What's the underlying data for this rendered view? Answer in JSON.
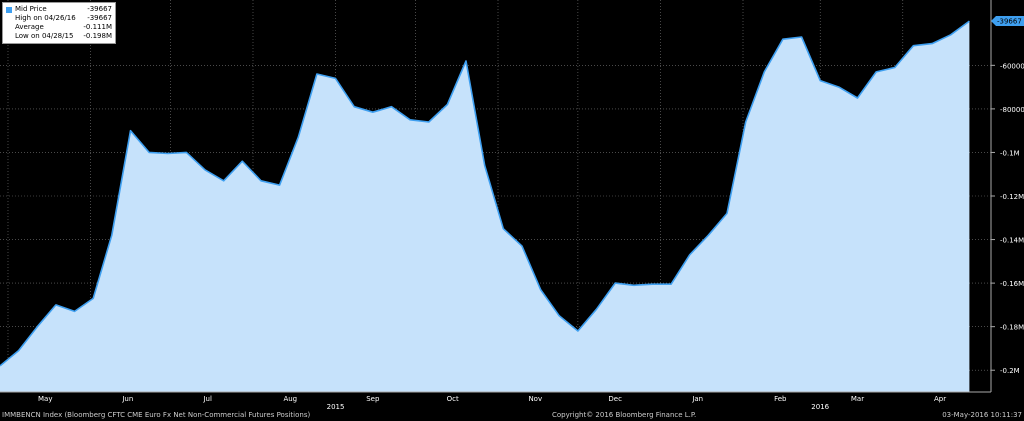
{
  "legend": {
    "series_label": "Mid Price",
    "series_value": "-39667",
    "high_label": "High on 04/26/16",
    "high_value": "-39667",
    "avg_label": "Average",
    "avg_value": "-0.111M",
    "low_label": "Low on 04/28/15",
    "low_value": "-0.198M"
  },
  "footer": {
    "left": "IMMBENCN Index (Bloomberg CFTC CME Euro Fx Net Non-Commercial Futures Positions)",
    "center": "Copyright© 2016 Bloomberg Finance L.P.",
    "right": "03-May-2016 10:11:37"
  },
  "colors": {
    "line": "#3e9ff0",
    "fill": "#c6e2fb",
    "background": "#000000",
    "grid": "#888888"
  },
  "chart_data": {
    "type": "area",
    "ylim": [
      -210000,
      -30000
    ],
    "y_ticks": [
      {
        "v": -60000,
        "label": "-60000"
      },
      {
        "v": -80000,
        "label": "-80000"
      },
      {
        "v": -100000,
        "label": "-0.1M"
      },
      {
        "v": -120000,
        "label": "-0.12M"
      },
      {
        "v": -140000,
        "label": "-0.14M"
      },
      {
        "v": -160000,
        "label": "-0.16M"
      },
      {
        "v": -180000,
        "label": "-0.18M"
      },
      {
        "v": -200000,
        "label": "-0.2M"
      }
    ],
    "last_value_label": "-39667",
    "last_value": -39667,
    "x_range": [
      "2015-04-28",
      "2016-05-03"
    ],
    "months": [
      {
        "label": "May",
        "date": "2015-05-15"
      },
      {
        "label": "Jun",
        "date": "2015-06-15"
      },
      {
        "label": "Jul",
        "date": "2015-07-15"
      },
      {
        "label": "Aug",
        "date": "2015-08-15"
      },
      {
        "label": "Sep",
        "date": "2015-09-15"
      },
      {
        "label": "Oct",
        "date": "2015-10-15"
      },
      {
        "label": "Nov",
        "date": "2015-11-15"
      },
      {
        "label": "Dec",
        "date": "2015-12-15"
      },
      {
        "label": "Jan",
        "date": "2016-01-15"
      },
      {
        "label": "Feb",
        "date": "2016-02-15"
      },
      {
        "label": "Mar",
        "date": "2016-03-15"
      },
      {
        "label": "Apr",
        "date": "2016-04-15"
      }
    ],
    "years": [
      {
        "label": "2015",
        "date": "2015-09-01"
      },
      {
        "label": "2016",
        "date": "2016-03-01"
      }
    ],
    "points": [
      {
        "x": "2015-04-28",
        "y": -198000
      },
      {
        "x": "2015-05-05",
        "y": -191000
      },
      {
        "x": "2015-05-12",
        "y": -180000
      },
      {
        "x": "2015-05-19",
        "y": -170000
      },
      {
        "x": "2015-05-26",
        "y": -173000
      },
      {
        "x": "2015-06-02",
        "y": -167000
      },
      {
        "x": "2015-06-09",
        "y": -138000
      },
      {
        "x": "2015-06-16",
        "y": -90000
      },
      {
        "x": "2015-06-23",
        "y": -100000
      },
      {
        "x": "2015-06-30",
        "y": -100500
      },
      {
        "x": "2015-07-07",
        "y": -100000
      },
      {
        "x": "2015-07-14",
        "y": -108000
      },
      {
        "x": "2015-07-21",
        "y": -113000
      },
      {
        "x": "2015-07-28",
        "y": -104000
      },
      {
        "x": "2015-08-04",
        "y": -113000
      },
      {
        "x": "2015-08-11",
        "y": -115000
      },
      {
        "x": "2015-08-18",
        "y": -93000
      },
      {
        "x": "2015-08-25",
        "y": -64000
      },
      {
        "x": "2015-09-01",
        "y": -66000
      },
      {
        "x": "2015-09-08",
        "y": -79000
      },
      {
        "x": "2015-09-15",
        "y": -81500
      },
      {
        "x": "2015-09-22",
        "y": -79000
      },
      {
        "x": "2015-09-29",
        "y": -85000
      },
      {
        "x": "2015-10-06",
        "y": -86000
      },
      {
        "x": "2015-10-13",
        "y": -78000
      },
      {
        "x": "2015-10-20",
        "y": -58000
      },
      {
        "x": "2015-10-27",
        "y": -106000
      },
      {
        "x": "2015-11-03",
        "y": -135000
      },
      {
        "x": "2015-11-10",
        "y": -143000
      },
      {
        "x": "2015-11-17",
        "y": -163000
      },
      {
        "x": "2015-11-24",
        "y": -175000
      },
      {
        "x": "2015-12-01",
        "y": -182000
      },
      {
        "x": "2015-12-08",
        "y": -172000
      },
      {
        "x": "2015-12-15",
        "y": -160000
      },
      {
        "x": "2015-12-22",
        "y": -161000
      },
      {
        "x": "2015-12-29",
        "y": -160500
      },
      {
        "x": "2016-01-05",
        "y": -160500
      },
      {
        "x": "2016-01-12",
        "y": -147000
      },
      {
        "x": "2016-01-19",
        "y": -138000
      },
      {
        "x": "2016-01-26",
        "y": -128000
      },
      {
        "x": "2016-02-02",
        "y": -86000
      },
      {
        "x": "2016-02-09",
        "y": -63000
      },
      {
        "x": "2016-02-16",
        "y": -48000
      },
      {
        "x": "2016-02-23",
        "y": -47000
      },
      {
        "x": "2016-03-01",
        "y": -67000
      },
      {
        "x": "2016-03-08",
        "y": -70000
      },
      {
        "x": "2016-03-15",
        "y": -75000
      },
      {
        "x": "2016-03-22",
        "y": -63000
      },
      {
        "x": "2016-03-29",
        "y": -61000
      },
      {
        "x": "2016-04-05",
        "y": -51000
      },
      {
        "x": "2016-04-12",
        "y": -50000
      },
      {
        "x": "2016-04-19",
        "y": -46000
      },
      {
        "x": "2016-04-26",
        "y": -39667
      }
    ]
  }
}
